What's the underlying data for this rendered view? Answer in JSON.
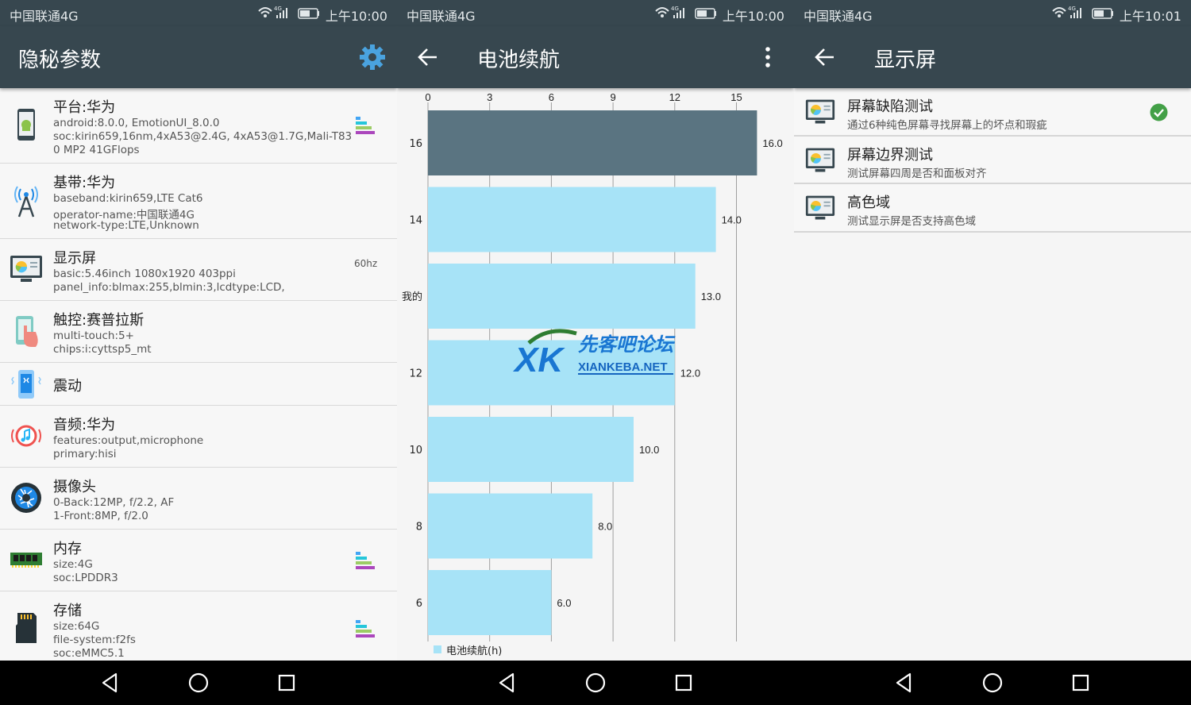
{
  "status": [
    {
      "carrier": "中国联通4G",
      "time": "上午10:00"
    },
    {
      "carrier": "中国联通4G",
      "time": "上午10:00"
    },
    {
      "carrier": "中国联通4G",
      "time": "上午10:01"
    }
  ],
  "screen1": {
    "title": "隐秘参数",
    "action_icon": "gear-icon",
    "items": [
      {
        "title": "平台:华为",
        "lines": [
          "android:8.0.0, EmotionUI_8.0.0",
          "soc:kirin659,16nm,4xA53@2.4G, 4xA53@1.7G,Mali-T83",
          "0 MP2 41GFlops"
        ],
        "icon": "android-phone-icon",
        "badge": "",
        "bars": true
      },
      {
        "title": "基带:华为",
        "lines": [
          "baseband:kirin659,LTE Cat6",
          "operator-name:中国联通4G",
          "network-type:LTE,Unknown"
        ],
        "icon": "antenna-icon",
        "badge": "",
        "bars": false
      },
      {
        "title": "显示屏",
        "lines": [
          "basic:5.46inch 1080x1920 403ppi",
          "panel_info:blmax:255,blmin:3,lcdtype:LCD,"
        ],
        "icon": "monitor-icon",
        "badge": "60hz",
        "bars": false
      },
      {
        "title": "触控:赛普拉斯",
        "lines": [
          "multi-touch:5+",
          "chips:i:cyttsp5_mt"
        ],
        "icon": "touch-icon",
        "badge": "",
        "bars": false
      },
      {
        "title": "震动",
        "lines": [],
        "icon": "vibration-icon",
        "badge": "",
        "bars": false
      },
      {
        "title": "音频:华为",
        "lines": [
          "features:output,microphone",
          "primary:hisi"
        ],
        "icon": "audio-icon",
        "badge": "",
        "bars": false
      },
      {
        "title": "摄像头",
        "lines": [
          "0-Back:12MP, f/2.2, AF",
          "1-Front:8MP, f/2.0"
        ],
        "icon": "camera-icon",
        "badge": "",
        "bars": false
      },
      {
        "title": "内存",
        "lines": [
          "size:4G",
          "soc:LPDDR3"
        ],
        "icon": "memory-icon",
        "badge": "",
        "bars": true
      },
      {
        "title": "存储",
        "lines": [
          "size:64G",
          "file-system:f2fs",
          "soc:eMMC5.1"
        ],
        "icon": "sdcard-icon",
        "badge": "",
        "bars": true
      }
    ]
  },
  "screen2": {
    "title": "电池续航",
    "action_icon": "more-vert-icon",
    "back_icon": "back-arrow-icon"
  },
  "chart_data": {
    "type": "bar",
    "orientation": "horizontal",
    "categories": [
      "16",
      "14",
      "我的",
      "12",
      "10",
      "8",
      "6"
    ],
    "values": [
      16.0,
      14.0,
      13.0,
      12.0,
      10.0,
      8.0,
      6.0
    ],
    "value_labels": [
      "16.0",
      "14.0",
      "13.0",
      "12.0",
      "10.0",
      "8.0",
      "6.0"
    ],
    "highlight_category": "16",
    "x_ticks": [
      0,
      3,
      6,
      9,
      12,
      15
    ],
    "xlim": [
      0,
      17
    ],
    "axis_position": "top",
    "legend": "电池续航(h)",
    "legend_position": "bottom-left",
    "grid": true,
    "colors": {
      "bar": "#a7e3f7",
      "highlight": "#5a7481"
    }
  },
  "screen3": {
    "title": "显示屏",
    "back_icon": "back-arrow-icon",
    "items": [
      {
        "title": "屏幕缺陷测试",
        "sub": "通过6种纯色屏幕寻找屏幕上的坏点和瑕疵",
        "checked": true
      },
      {
        "title": "屏幕边界测试",
        "sub": "测试屏幕四周是否和面板对齐",
        "checked": false
      },
      {
        "title": "高色域",
        "sub": "测试显示屏是否支持高色域",
        "checked": false
      }
    ]
  },
  "watermark": {
    "cn": "先客吧论坛",
    "en": "XIANKEBA.NET",
    "logo": "XK"
  },
  "colors": {
    "toolbar": "#37474f",
    "accent": "#4caf50",
    "navbar": "#000000"
  }
}
